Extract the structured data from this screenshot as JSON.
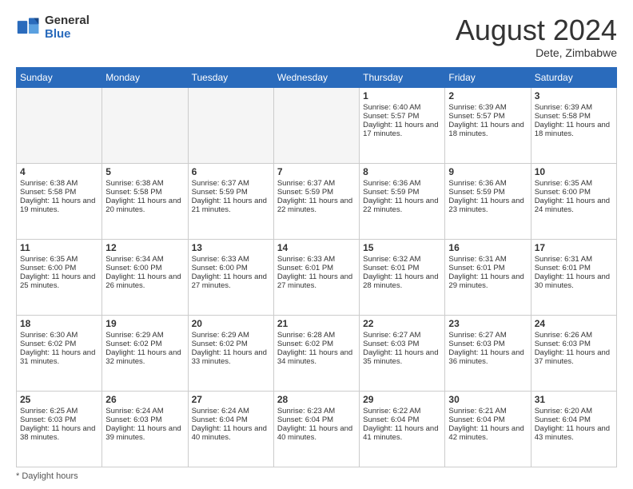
{
  "header": {
    "logo_general": "General",
    "logo_blue": "Blue",
    "month_year": "August 2024",
    "location": "Dete, Zimbabwe"
  },
  "days_of_week": [
    "Sunday",
    "Monday",
    "Tuesday",
    "Wednesday",
    "Thursday",
    "Friday",
    "Saturday"
  ],
  "weeks": [
    [
      {
        "day": "",
        "empty": true
      },
      {
        "day": "",
        "empty": true
      },
      {
        "day": "",
        "empty": true
      },
      {
        "day": "",
        "empty": true
      },
      {
        "day": "1",
        "sunrise": "6:40 AM",
        "sunset": "5:57 PM",
        "daylight": "11 hours and 17 minutes."
      },
      {
        "day": "2",
        "sunrise": "6:39 AM",
        "sunset": "5:57 PM",
        "daylight": "11 hours and 18 minutes."
      },
      {
        "day": "3",
        "sunrise": "6:39 AM",
        "sunset": "5:58 PM",
        "daylight": "11 hours and 18 minutes."
      }
    ],
    [
      {
        "day": "4",
        "sunrise": "6:38 AM",
        "sunset": "5:58 PM",
        "daylight": "11 hours and 19 minutes."
      },
      {
        "day": "5",
        "sunrise": "6:38 AM",
        "sunset": "5:58 PM",
        "daylight": "11 hours and 20 minutes."
      },
      {
        "day": "6",
        "sunrise": "6:37 AM",
        "sunset": "5:59 PM",
        "daylight": "11 hours and 21 minutes."
      },
      {
        "day": "7",
        "sunrise": "6:37 AM",
        "sunset": "5:59 PM",
        "daylight": "11 hours and 22 minutes."
      },
      {
        "day": "8",
        "sunrise": "6:36 AM",
        "sunset": "5:59 PM",
        "daylight": "11 hours and 22 minutes."
      },
      {
        "day": "9",
        "sunrise": "6:36 AM",
        "sunset": "5:59 PM",
        "daylight": "11 hours and 23 minutes."
      },
      {
        "day": "10",
        "sunrise": "6:35 AM",
        "sunset": "6:00 PM",
        "daylight": "11 hours and 24 minutes."
      }
    ],
    [
      {
        "day": "11",
        "sunrise": "6:35 AM",
        "sunset": "6:00 PM",
        "daylight": "11 hours and 25 minutes."
      },
      {
        "day": "12",
        "sunrise": "6:34 AM",
        "sunset": "6:00 PM",
        "daylight": "11 hours and 26 minutes."
      },
      {
        "day": "13",
        "sunrise": "6:33 AM",
        "sunset": "6:00 PM",
        "daylight": "11 hours and 27 minutes."
      },
      {
        "day": "14",
        "sunrise": "6:33 AM",
        "sunset": "6:01 PM",
        "daylight": "11 hours and 27 minutes."
      },
      {
        "day": "15",
        "sunrise": "6:32 AM",
        "sunset": "6:01 PM",
        "daylight": "11 hours and 28 minutes."
      },
      {
        "day": "16",
        "sunrise": "6:31 AM",
        "sunset": "6:01 PM",
        "daylight": "11 hours and 29 minutes."
      },
      {
        "day": "17",
        "sunrise": "6:31 AM",
        "sunset": "6:01 PM",
        "daylight": "11 hours and 30 minutes."
      }
    ],
    [
      {
        "day": "18",
        "sunrise": "6:30 AM",
        "sunset": "6:02 PM",
        "daylight": "11 hours and 31 minutes."
      },
      {
        "day": "19",
        "sunrise": "6:29 AM",
        "sunset": "6:02 PM",
        "daylight": "11 hours and 32 minutes."
      },
      {
        "day": "20",
        "sunrise": "6:29 AM",
        "sunset": "6:02 PM",
        "daylight": "11 hours and 33 minutes."
      },
      {
        "day": "21",
        "sunrise": "6:28 AM",
        "sunset": "6:02 PM",
        "daylight": "11 hours and 34 minutes."
      },
      {
        "day": "22",
        "sunrise": "6:27 AM",
        "sunset": "6:03 PM",
        "daylight": "11 hours and 35 minutes."
      },
      {
        "day": "23",
        "sunrise": "6:27 AM",
        "sunset": "6:03 PM",
        "daylight": "11 hours and 36 minutes."
      },
      {
        "day": "24",
        "sunrise": "6:26 AM",
        "sunset": "6:03 PM",
        "daylight": "11 hours and 37 minutes."
      }
    ],
    [
      {
        "day": "25",
        "sunrise": "6:25 AM",
        "sunset": "6:03 PM",
        "daylight": "11 hours and 38 minutes."
      },
      {
        "day": "26",
        "sunrise": "6:24 AM",
        "sunset": "6:03 PM",
        "daylight": "11 hours and 39 minutes."
      },
      {
        "day": "27",
        "sunrise": "6:24 AM",
        "sunset": "6:04 PM",
        "daylight": "11 hours and 40 minutes."
      },
      {
        "day": "28",
        "sunrise": "6:23 AM",
        "sunset": "6:04 PM",
        "daylight": "11 hours and 40 minutes."
      },
      {
        "day": "29",
        "sunrise": "6:22 AM",
        "sunset": "6:04 PM",
        "daylight": "11 hours and 41 minutes."
      },
      {
        "day": "30",
        "sunrise": "6:21 AM",
        "sunset": "6:04 PM",
        "daylight": "11 hours and 42 minutes."
      },
      {
        "day": "31",
        "sunrise": "6:20 AM",
        "sunset": "6:04 PM",
        "daylight": "11 hours and 43 minutes."
      }
    ]
  ],
  "footer": {
    "note": "Daylight hours"
  },
  "labels": {
    "sunrise": "Sunrise:",
    "sunset": "Sunset:",
    "daylight": "Daylight:"
  }
}
